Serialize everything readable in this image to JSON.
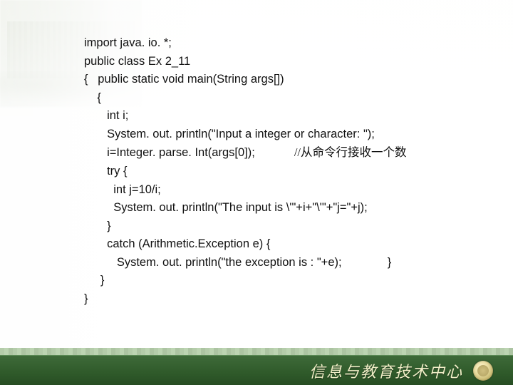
{
  "code": {
    "l1": "import java. io. *;",
    "l2": "public class Ex 2_11",
    "l3": "{   public static void main(String args[])",
    "l4": "    {",
    "l5": "       int i;",
    "l6": "       System. out. println(\"Input a integer or character: \");",
    "l7a": "       i=Integer. parse. Int(args[0]);            ",
    "l7b": "//从命令行接收一个数",
    "l8": "       try {",
    "l9": "         int j=10/i;",
    "l10": "         System. out. println(\"The input is \\'\"+i+\"\\'\"+\"j=\"+j);",
    "l11": "       }",
    "l12": "       catch (Arithmetic.Exception e) {",
    "l13a": "          System. out. println(\"the exception is : \"+e);",
    "l13b": "              }",
    "l14": "     }",
    "l15": "}"
  },
  "footer": {
    "text": "信息与教育技术中心"
  }
}
